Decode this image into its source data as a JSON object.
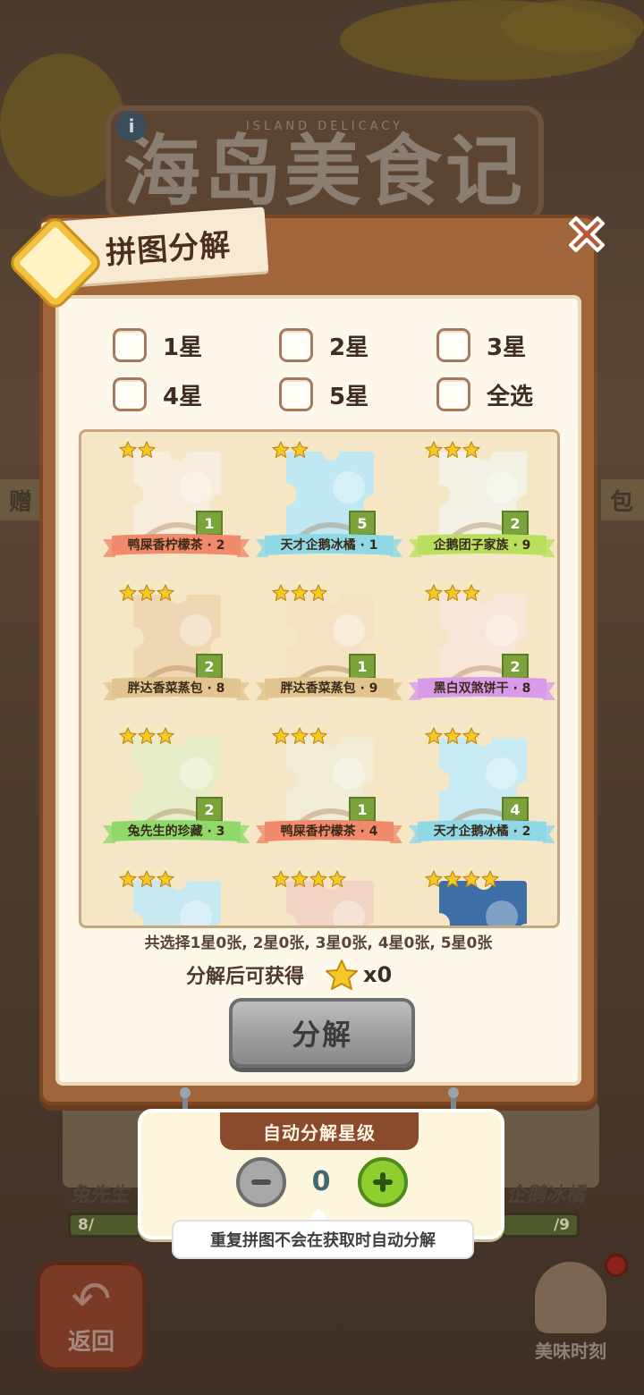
{
  "background": {
    "game_title": "海岛美食记",
    "game_subtitle": "ISLAND DELICACY",
    "info_icon_label": "i",
    "side_tab_left": "赠",
    "side_tab_right": "包",
    "card_left_label": "兔先生",
    "card_right_label": "企鹅冰橘",
    "card_left_progress": "8/",
    "card_right_progress": "/9",
    "back_label": "返回",
    "moment_label": "美味时刻"
  },
  "panel": {
    "title": "拼图分解",
    "close_icon": "close-x-icon"
  },
  "filters": [
    {
      "label": "1星",
      "checked": false
    },
    {
      "label": "2星",
      "checked": false
    },
    {
      "label": "3星",
      "checked": false
    },
    {
      "label": "4星",
      "checked": false
    },
    {
      "label": "5星",
      "checked": false
    },
    {
      "label": "全选",
      "checked": false
    }
  ],
  "pieces": [
    {
      "name": "鸭屎香柠檬茶 · 2",
      "stars": 2,
      "count": "1",
      "ribbon_color": "#f08a6a",
      "art": "#f7eddc"
    },
    {
      "name": "天才企鹅冰橘 · 1",
      "stars": 2,
      "count": "5",
      "ribbon_color": "#8fd8e6",
      "art": "#bfe8f2"
    },
    {
      "name": "企鹅团子家族 · 9",
      "stars": 3,
      "count": "2",
      "ribbon_color": "#b9df5e",
      "art": "#f3f1e6"
    },
    {
      "name": "胖达香菜蒸包 · 8",
      "stars": 3,
      "count": "2",
      "ribbon_color": "#e2c48e",
      "art": "#f0d7b4"
    },
    {
      "name": "胖达香菜蒸包 · 9",
      "stars": 3,
      "count": "1",
      "ribbon_color": "#e2c48e",
      "art": "#f3e3c3"
    },
    {
      "name": "黑白双煞饼干 · 8",
      "stars": 3,
      "count": "2",
      "ribbon_color": "#d79be8",
      "art": "#f7e7da"
    },
    {
      "name": "兔先生的珍藏 · 3",
      "stars": 3,
      "count": "2",
      "ribbon_color": "#8fd86a",
      "art": "#e7edc8"
    },
    {
      "name": "鸭屎香柠檬茶 · 4",
      "stars": 3,
      "count": "1",
      "ribbon_color": "#f08a6a",
      "art": "#f1ecd6"
    },
    {
      "name": "天才企鹅冰橘 · 2",
      "stars": 3,
      "count": "4",
      "ribbon_color": "#8fd8e6",
      "art": "#c7eaf3"
    },
    {
      "name": "",
      "stars": 3,
      "count": "",
      "ribbon_color": "",
      "art": "#c7e7f1"
    },
    {
      "name": "",
      "stars": 4,
      "count": "",
      "ribbon_color": "",
      "art": "#f1d4c4"
    },
    {
      "name": "",
      "stars": 4,
      "count": "",
      "ribbon_color": "",
      "art": "#3d6fa6"
    }
  ],
  "summary": "共选择1星0张, 2星0张, 3星0张, 4星0张, 5星0张",
  "reward": {
    "label": "分解后可获得",
    "icon": "star-icon",
    "quantity": "x0"
  },
  "decompose_button": "分解",
  "auto_decompose": {
    "title": "自动分解星级",
    "value": "0",
    "minus_icon": "minus-icon",
    "plus_icon": "plus-icon",
    "tooltip": "重复拼图不会在获取时自动分解"
  },
  "colors": {
    "frame": "#a0653a",
    "inner": "#fdf8ea",
    "accent_green": "#8ccf2f",
    "star_yellow": "#f6c928",
    "disabled_gray": "#9b9b9b"
  }
}
